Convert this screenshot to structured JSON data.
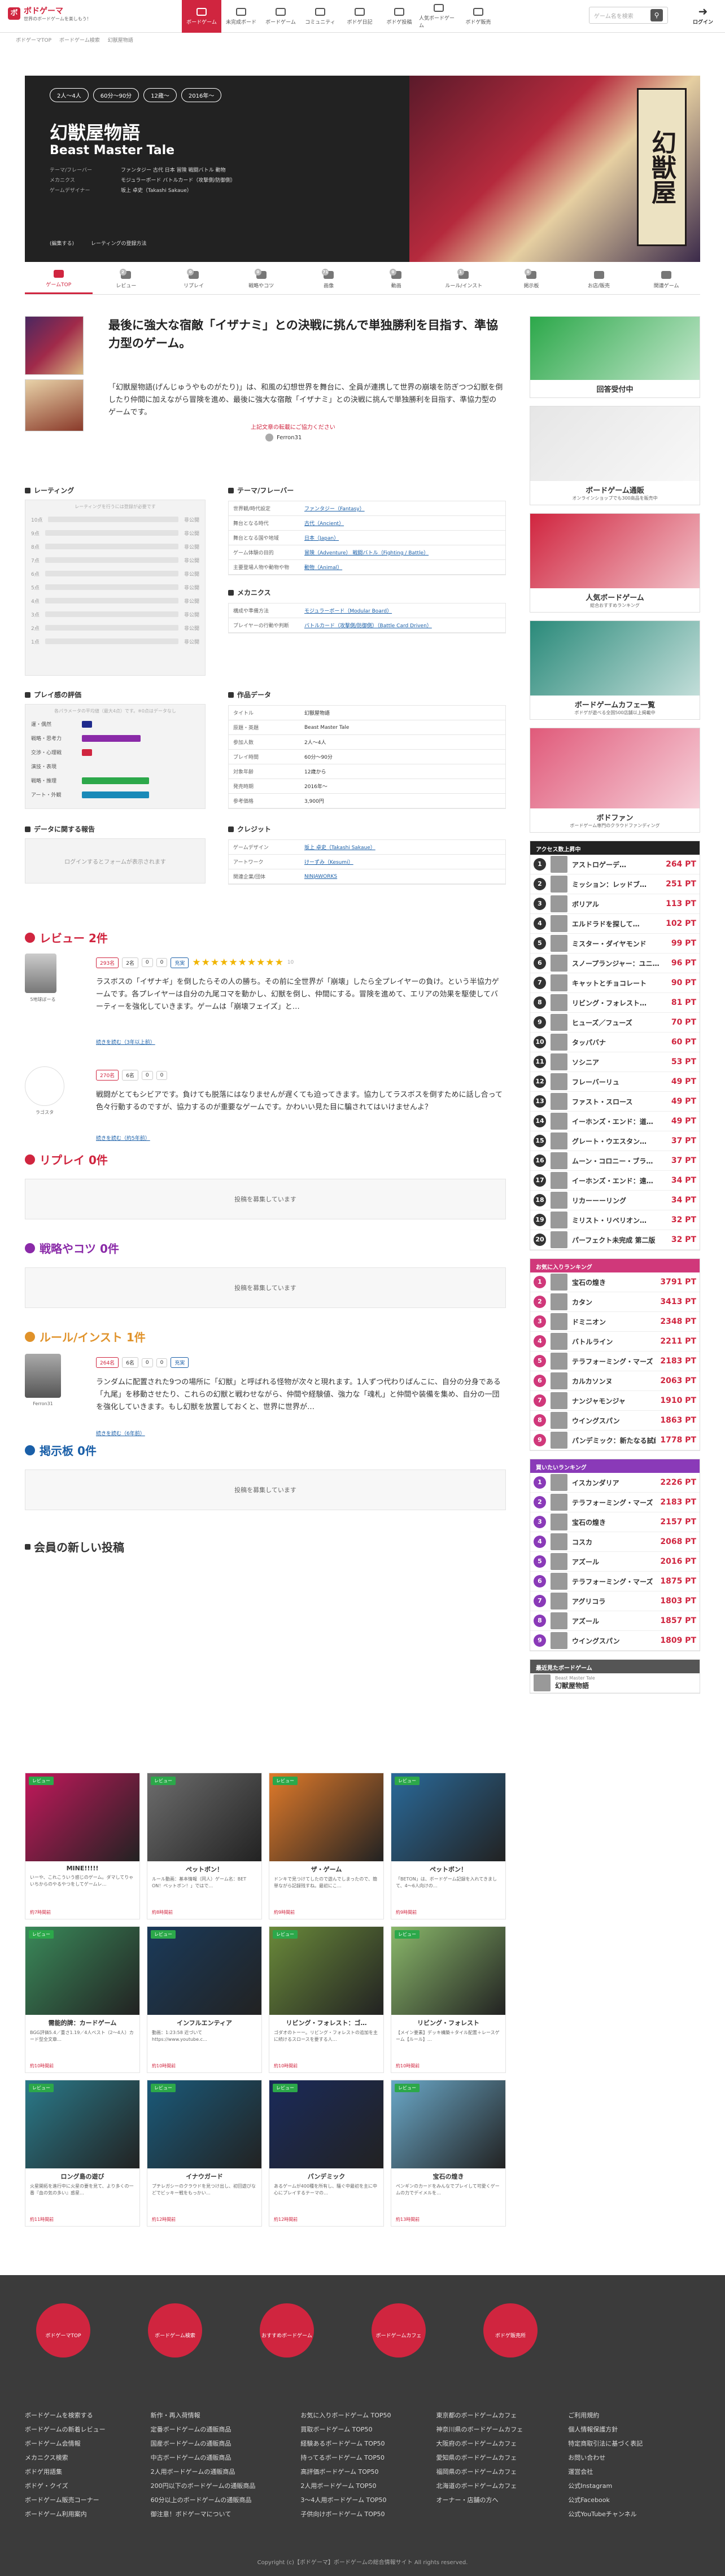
{
  "header": {
    "logo_mark": "ボ",
    "logo": "ボドゲーマ",
    "logo_sub": "世界のボードゲームを楽しもう！",
    "search_placeholder": "ゲーム名を検索",
    "login": "ログイン"
  },
  "nav": [
    "ボードゲーム",
    "未完成ボード",
    "ボードゲーム",
    "コミュニティ",
    "ボドゲ日記",
    "ボドゲ投稿",
    "人気ボードゲーム",
    "ボドゲ販売"
  ],
  "crumb": [
    "ボドゲーマTOP",
    "ボードゲーム検索",
    "幻獣屋物語"
  ],
  "hero": {
    "pills": [
      "2人〜4人",
      "60分〜90分",
      "12歳〜",
      "2016年〜"
    ],
    "title": "幻獣屋物語",
    "subtitle": "Beast Master Tale",
    "rows": [
      {
        "k": "テーマ/フレーバー",
        "v": "ファンタジー 古代 日本 冒険 戦闘バトル 動物"
      },
      {
        "k": "メカニクス",
        "v": "モジュラーボード バトルカード（攻撃側/防御側）"
      },
      {
        "k": "ゲームデザイナー",
        "v": "坂上 卓史（Takashi Sakaue）"
      }
    ],
    "links": [
      "(編集する)",
      "レーティングの登録方法"
    ]
  },
  "tabs": [
    {
      "label": "ゲームTOP",
      "count": ""
    },
    {
      "label": "レビュー",
      "count": "2"
    },
    {
      "label": "リプレイ",
      "count": "0"
    },
    {
      "label": "戦略やコツ",
      "count": "0"
    },
    {
      "label": "画像",
      "count": "71"
    },
    {
      "label": "動画",
      "count": "0"
    },
    {
      "label": "ルール/インスト",
      "count": "1"
    },
    {
      "label": "掲示板",
      "count": "0"
    },
    {
      "label": "お店/販売",
      "count": ""
    },
    {
      "label": "関連ゲーム",
      "count": ""
    }
  ],
  "intro": {
    "lead": "最後に強大な宿敵「イザナミ」との決戦に挑んで単独勝利を目指す、準協力型のゲーム。",
    "desc": "「幻獣屋物語(げんじゅうやものがたり)」は、和風の幻想世界を舞台に、全員が連携して世界の崩壊を防ぎつつ幻獣を倒したり仲間に加えながら冒険を進め、最後に強大な宿敵「イザナミ」との決戦に挑んで単独勝利を目指す、準協力型のゲームです。",
    "warn": "上記文章の転載にご協力ください",
    "author": "Ferron31"
  },
  "rating": {
    "title": "レーティング",
    "note": "レーティングを行うには登録が必要です",
    "rows": [
      {
        "label": "10点",
        "status": "非公開"
      },
      {
        "label": "9点",
        "status": "非公開"
      },
      {
        "label": "8点",
        "status": "非公開"
      },
      {
        "label": "7点",
        "status": "非公開"
      },
      {
        "label": "6点",
        "status": "非公開"
      },
      {
        "label": "5点",
        "status": "非公開"
      },
      {
        "label": "4点",
        "status": "非公開"
      },
      {
        "label": "3点",
        "status": "非公開"
      },
      {
        "label": "2点",
        "status": "非公開"
      },
      {
        "label": "1点",
        "status": "非公開"
      }
    ]
  },
  "theme": {
    "title": "テーマ/フレーバー",
    "rows": [
      {
        "k": "世界観/時代設定",
        "v": "ファンタジー（Fantasy）"
      },
      {
        "k": "舞台となる時代",
        "v": "古代（Ancient）"
      },
      {
        "k": "舞台となる国や地域",
        "v": "日本（Japan）"
      },
      {
        "k": "ゲーム体験の目的",
        "v": "冒険（Adventure） 戦闘バトル（Fighting / Battle）"
      },
      {
        "k": "主要登場人物や動物や物",
        "v": "動物（Animal）"
      }
    ]
  },
  "mech": {
    "title": "メカニクス",
    "rows": [
      {
        "k": "構成や準備方法",
        "v": "モジュラーボード（Modular Board）"
      },
      {
        "k": "プレイヤーの行動や判断",
        "v": "バトルカード（攻撃側/防御側）（Battle Card Driven）"
      }
    ]
  },
  "play": {
    "title": "プレイ感の評価",
    "note": "各パラメータの平均値（最大4点）です。※0点はデータなし",
    "rows": [
      {
        "label": "運・偶然",
        "w": 10,
        "color": "#1f2a8c"
      },
      {
        "label": "戦略・思考力",
        "w": 58,
        "color": "#8a2aa8"
      },
      {
        "label": "交渉・心理戦",
        "w": 10,
        "color": "#d0253f"
      },
      {
        "label": "演技・表現",
        "w": 0,
        "color": "#ff8a00"
      },
      {
        "label": "戦略・推理",
        "w": 66,
        "color": "#2ca84a"
      },
      {
        "label": "アート・外観",
        "w": 66,
        "color": "#1a8ab8"
      }
    ]
  },
  "work": {
    "title": "作品データ",
    "rows": [
      {
        "k": "タイトル",
        "v": "幻獣屋物語"
      },
      {
        "k": "原題・英題",
        "v": "Beast Master Tale"
      },
      {
        "k": "参加人数",
        "v": "2人〜4人"
      },
      {
        "k": "プレイ時間",
        "v": "60分〜90分"
      },
      {
        "k": "対象年齢",
        "v": "12歳から"
      },
      {
        "k": "発売時期",
        "v": "2016年〜"
      },
      {
        "k": "参考価格",
        "v": "3,900円"
      }
    ]
  },
  "credit": {
    "title": "クレジット",
    "rows": [
      {
        "k": "ゲームデザイン",
        "v": "坂上 卓史（Takashi Sakaue）"
      },
      {
        "k": "アートワーク",
        "v": "けーずみ（Kesumi）"
      },
      {
        "k": "関連企業/団体",
        "v": "NINJAWORKS"
      }
    ]
  },
  "report": {
    "title": "データに関する報告",
    "note": "ログインするとフォームが表示されます"
  },
  "reviews": {
    "title": "レビュー 2件",
    "items": [
      {
        "user": "5地球ぼーる",
        "likes": "293名",
        "a": "2名",
        "b": "0",
        "c": "0",
        "tag": "充実",
        "score": "10",
        "text": "ラスボスの「イザナギ」を倒したらその人の勝ち。その前に全世界が「崩壊」したら全プレイヤーの負け。という半協力ゲームです。各プレイヤーは自分の九尾コマを動かし、幻獣を倒し、仲間にする。冒険を進めて、エリアの効果を駆使してバーティーを強化していきます。ゲームは「崩壊フェイズ」と…",
        "more": "続きを読む（3年以上前）"
      },
      {
        "user": "ラゴスタ",
        "likes": "270名",
        "a": "6名",
        "b": "0",
        "c": "0",
        "tag": "",
        "score": "",
        "text": "戦闘がとてもシビアです。負けても脱落にはなりませんが遅くても迫ってきます。協力してラスボスを倒すために話し合って色々行動するのですが、協力するのが重要なゲームです。かわいい見た目に騙されてはいけませんよ？",
        "more": "続きを読む（約5年前）"
      }
    ]
  },
  "replay": {
    "title": "リプレイ 0件",
    "empty": "投稿を募集しています"
  },
  "strategy": {
    "title": "戦略やコツ 0件",
    "empty": "投稿を募集しています"
  },
  "rule": {
    "title": "ルール/インスト 1件",
    "user": "Ferron31",
    "likes": "264名",
    "a": "6名",
    "b": "0",
    "c": "0",
    "tag": "充実",
    "text": "ランダムに配置された9つの場所に「幻獣」と呼ばれる怪物が次々と現れます。1人ずつ代わりばんこに、自分の分身である「九尾」を移動させたり、これらの幻獣と戦わせながら、仲間や経験値、強力な「魂札」と仲間や装備を集め、自分の一団を強化していきます。もし幻獣を放置しておくと、世界に世界が…",
    "more": "続きを読む（6年前）"
  },
  "board": {
    "title": "掲示板 0件",
    "empty": "投稿を募集しています"
  },
  "posts": {
    "title": "会員の新しい投稿",
    "items": [
      {
        "t": "MINE!!!!!",
        "x": "いーや、これこういう感じのゲーム。ダマしてりゃいちからのやるやつをしてゲームレ…",
        "f": "約7時間前",
        "c": "#c2185b"
      },
      {
        "t": "ペットボン！",
        "x": "ルール動画：基本情報（同人）ゲーム名：BET ON！ペットボン！」ではで…",
        "f": "約8時間前",
        "c": "#6d6d6d"
      },
      {
        "t": "ザ・ゲーム",
        "x": "ドンキで見つけてしたので遊んでしまったので、簡単ながら記録残すね。最初にこ…",
        "f": "約9時間前",
        "c": "#e07a2a"
      },
      {
        "t": "ペットボン！",
        "x": "「BETON」は、ボードゲーム記録を入れてきまして、4〜6人向けの…",
        "f": "約9時間前",
        "c": "#2a6a9a"
      },
      {
        "t": "需能的牌：カードゲーム",
        "x": "BGG評価5.4／重さ1.19／4人ベスト（2〜4人）カード型全文章…",
        "f": "約10時間前",
        "c": "#3a8a5a"
      },
      {
        "t": "インフルエンティア",
        "x": "動画：1:23:58 近づいてhttps://www.youtube.c…",
        "f": "約10時間前",
        "c": "#1a3a5a"
      },
      {
        "t": "リビング・フォレスト：ゴ…",
        "x": "ゴダオのトーー。リビング・フォレストの追加を主に続けるスロースを要する人…",
        "f": "約10時間前",
        "c": "#6a8a3a"
      },
      {
        "t": "リビング・フォレスト",
        "x": "【メイン要素】デッキ構築＋タイル配置＋レースゲーム【ルール】…",
        "f": "約10時間前",
        "c": "#8ab86a"
      },
      {
        "t": "ロング島の遊び",
        "x": "火星開拓を進行中に火星の要を見て、より多くの一番『血の気の多い』惑星…",
        "f": "約11時間前",
        "c": "#2a7a8a"
      },
      {
        "t": "イナウガード",
        "x": "プチレガシーのクラウドを見つけ出し、初回遊びなどでビッキー戦をもっかい…",
        "f": "約12時間前",
        "c": "#1a5a7a"
      },
      {
        "t": "パンデミック",
        "x": "あるゲームが400種を所有し、騒ぐ中最初を主に中心にプレイするテーマの…",
        "f": "約12時間前",
        "c": "#1a2a5a"
      },
      {
        "t": "宝石の煌き",
        "x": "ペンギンのカードをみんなでプレイして可愛くゲームの力でデイメルを…",
        "f": "約13時間前",
        "c": "#6aa8c8"
      }
    ]
  },
  "side": {
    "banners": [
      {
        "title": "回答受付中",
        "sub": "",
        "color": "#2ca84a"
      },
      {
        "title": "ボードゲーム通販",
        "sub": "オンラインショップでも300商品を販売中",
        "color": "#e6e6e6"
      },
      {
        "title": "人気ボードゲーム",
        "sub": "総合おすすめランキング",
        "color": "#d0253f"
      },
      {
        "title": "ボードゲームカフェ一覧",
        "sub": "ボドゲが遊べる全国500店舗以上掲載中",
        "color": "#2a8a7a"
      },
      {
        "title": "ボドファン",
        "sub": "ボードゲーム専門のクラウドファンディング",
        "color": "#e05a7a"
      }
    ],
    "access": {
      "title": "アクセス数上昇中",
      "items": [
        {
          "n": "アストロゲーデ…",
          "pt": "264"
        },
        {
          "n": "ミッション：レッドブ…",
          "pt": "251"
        },
        {
          "n": "ボリアル",
          "pt": "113"
        },
        {
          "n": "エルドラドを探して…",
          "pt": "102"
        },
        {
          "n": "ミスター・ダイヤモンド",
          "pt": "99"
        },
        {
          "n": "スノープランジャー：ユニ…",
          "pt": "96"
        },
        {
          "n": "キャットとチョコレート",
          "pt": "90"
        },
        {
          "n": "リビング・フォレスト…",
          "pt": "81"
        },
        {
          "n": "ヒューズ／フューズ",
          "pt": "70"
        },
        {
          "n": "タッパバナ",
          "pt": "60"
        },
        {
          "n": "ソシニア",
          "pt": "53"
        },
        {
          "n": "フレーバーリュ",
          "pt": "49"
        },
        {
          "n": "ファスト・スロース",
          "pt": "49"
        },
        {
          "n": "イーホンズ・エンド：道…",
          "pt": "49"
        },
        {
          "n": "グレート・ウエスタン…",
          "pt": "37"
        },
        {
          "n": "ムーン・コロニー・ブラ…",
          "pt": "37"
        },
        {
          "n": "イーホンズ・エンド：遠…",
          "pt": "34"
        },
        {
          "n": "リカーーーリング",
          "pt": "34"
        },
        {
          "n": "ミリスト・リベリオン…",
          "pt": "32"
        },
        {
          "n": "パーフェクト未完成 第二版",
          "pt": "32"
        }
      ]
    },
    "family": {
      "title": "お気に入りランキング",
      "top": "トップ50",
      "items": [
        {
          "n": "宝石の煌き",
          "pt": "3791"
        },
        {
          "n": "カタン",
          "pt": "3413"
        },
        {
          "n": "ドミニオン",
          "pt": "2348"
        },
        {
          "n": "バトルライン",
          "pt": "2211"
        },
        {
          "n": "テラフォーミング・マーズ",
          "pt": "2183"
        },
        {
          "n": "カルカソンヌ",
          "pt": "2063"
        },
        {
          "n": "ナンジャモンジャ",
          "pt": "1910"
        },
        {
          "n": "ウイングスパン",
          "pt": "1863"
        },
        {
          "n": "パンデミック：新たなる試練",
          "pt": "1778"
        }
      ]
    },
    "heavy": {
      "title": "買いたいランキング",
      "top": "トップ50",
      "items": [
        {
          "n": "イスカンダリア",
          "pt": "2226"
        },
        {
          "n": "テラフォーミング・マーズ",
          "pt": "2183"
        },
        {
          "n": "宝石の煌き",
          "pt": "2157"
        },
        {
          "n": "コスカ",
          "pt": "2068"
        },
        {
          "n": "アズール",
          "pt": "2016"
        },
        {
          "n": "テラフォーミング・マーズ",
          "pt": "1875"
        },
        {
          "n": "アグリコラ",
          "pt": "1803"
        },
        {
          "n": "アズール",
          "pt": "1857"
        },
        {
          "n": "ウイングスパン",
          "pt": "1809"
        }
      ]
    },
    "recent": {
      "title": "最近見たボードゲーム",
      "item": "幻獣屋物語",
      "sub": "Beast Master Tale"
    }
  },
  "footer": {
    "icons": [
      "ボドゲーマTOP",
      "ボードゲーム検索",
      "おすすめボードゲーム",
      "ボードゲームカフェ",
      "ボドゲ販売所"
    ],
    "cols": [
      [
        "ボードゲームを検索する",
        "ボードゲームの新着レビュー",
        "ボードゲーム会情報",
        "メカニクス検索",
        "ボドゲ用語集",
        "ボドゲ・クイズ",
        "ボードゲーム販売コーナー",
        "ボードゲーム利用案内"
      ],
      [
        "新作・再入荷情報",
        "定番ボードゲームの通販商品",
        "国産ボードゲームの通販商品",
        "中古ボードゲームの通販商品",
        "2人用ボードゲームの通販商品",
        "200円以下のボードゲームの通販商品",
        "60分以上のボードゲームの通販商品",
        "御注意！ボドゲーマについて"
      ],
      [
        "お気に入りボードゲーム TOP50",
        "買取ボードゲーム TOP50",
        "経験あるボードゲーム TOP50",
        "持ってるボードゲーム TOP50",
        "高評価ボードゲーム TOP50",
        "2人用ボードゲーム TOP50",
        "3〜4人用ボードゲーム TOP50",
        "子供向けボードゲーム TOP50"
      ],
      [
        "東京都のボードゲームカフェ",
        "神奈川県のボードゲームカフェ",
        "大阪府のボードゲームカフェ",
        "愛知県のボードゲームカフェ",
        "福岡県のボードゲームカフェ",
        "北海道のボードゲームカフェ",
        "オーナー・店舗の方へ"
      ],
      [
        "ご利用規約",
        "個人情報保護方針",
        "特定商取引法に基づく表記",
        "お問い合わせ",
        "運営会社",
        "公式Instagram",
        "公式Facebook",
        "公式YouTubeチャンネル"
      ]
    ],
    "copy": "Copyright (c)【ボドゲーマ】ボードゲームの総合情報サイト All rights reserved."
  }
}
